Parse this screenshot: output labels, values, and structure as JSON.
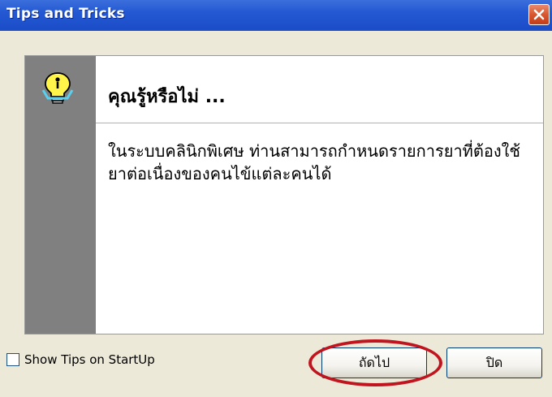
{
  "window": {
    "title": "Tips and Tricks",
    "close_icon": "close-icon"
  },
  "tip": {
    "icon": "lightbulb-icon",
    "heading": "คุณรู้หรือไม่ ...",
    "text": "ในระบบคลินิกพิเศษ ท่านสามารถกำหนดรายการยาที่ต้องใช้ยาต่อเนื่องของคนไข้แต่ละคนได้"
  },
  "footer": {
    "show_tips_label": "Show Tips on StartUp",
    "show_tips_checked": false,
    "next_label": "ถัดไป",
    "close_label": "ปิด"
  },
  "colors": {
    "titlebar": "#2458d3",
    "highlight": "#c0151f"
  }
}
